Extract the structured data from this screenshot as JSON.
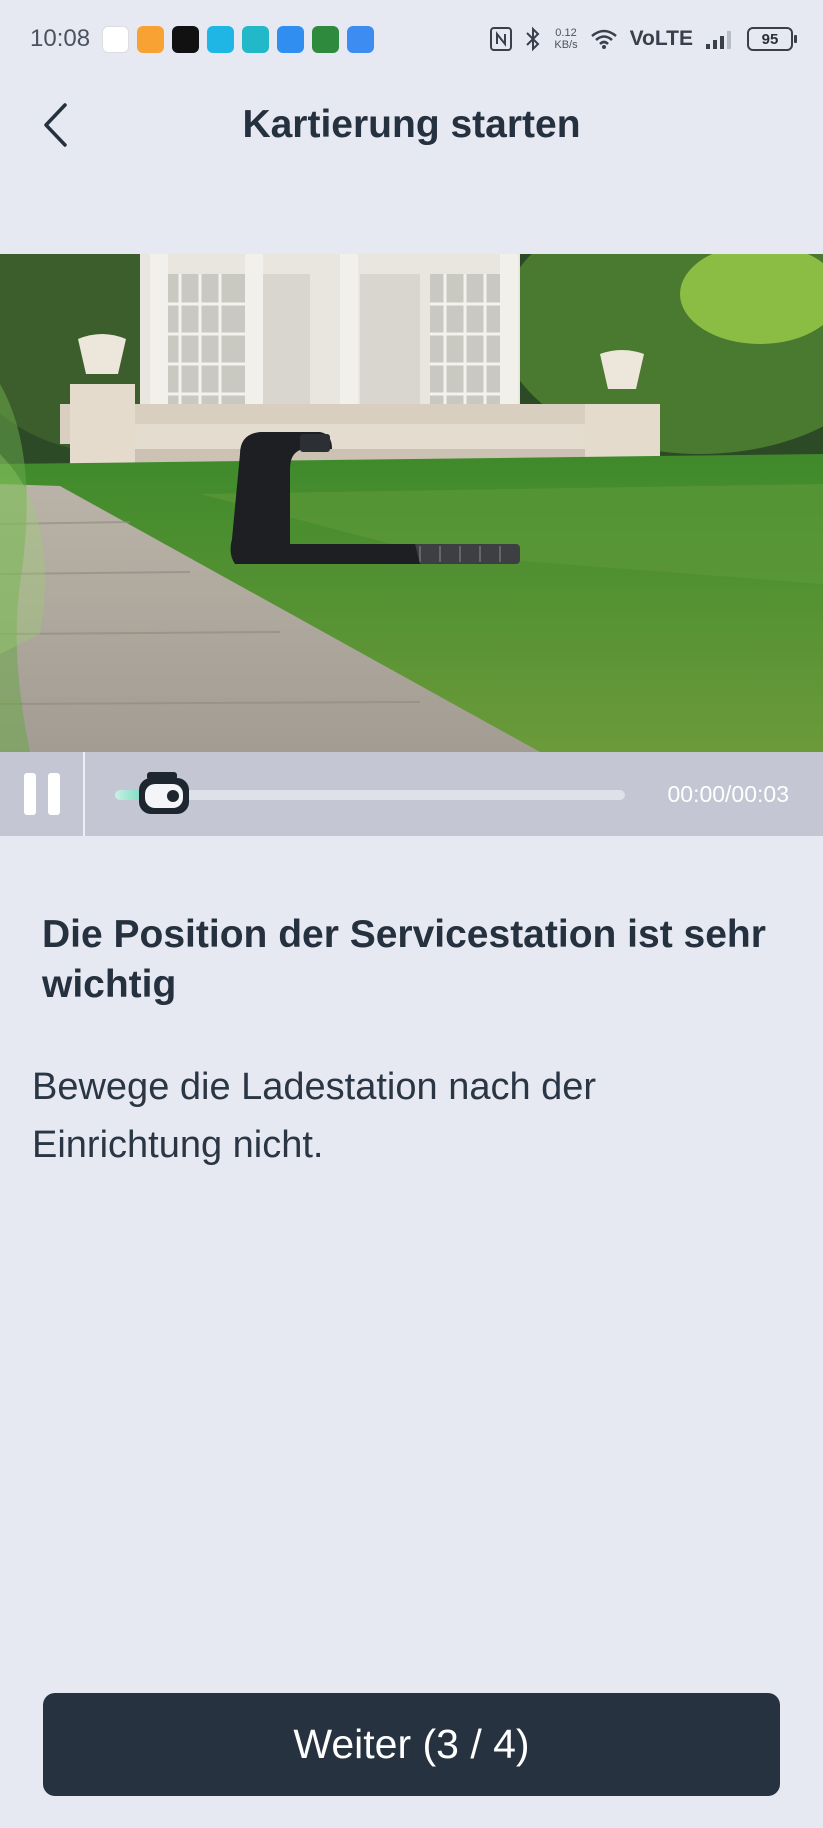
{
  "status_bar": {
    "time": "10:08",
    "net_speed_value": "0.12",
    "net_speed_unit": "KB/s",
    "network_label": "VoLTE",
    "battery": "95",
    "icons": [
      "nfc-icon",
      "bluetooth-icon",
      "wifi-icon",
      "signal-icon"
    ]
  },
  "header": {
    "title": "Kartierung starten",
    "back_icon": "chevron-left-icon"
  },
  "video": {
    "time_display": "00:00/00:03",
    "progress": 0.0,
    "playing": true
  },
  "content": {
    "title": "Die Position der Servicestation ist sehr wichtig",
    "description": "Bewege die Ladestation nach der Einrichtung nicht."
  },
  "footer": {
    "next_label": "Weiter (3 / 4)"
  },
  "colors": {
    "background": "#e6e9f2",
    "primary_button": "#263240",
    "progress_accent": "#5dd3b3",
    "controls_bg": "#c4c6d3"
  }
}
